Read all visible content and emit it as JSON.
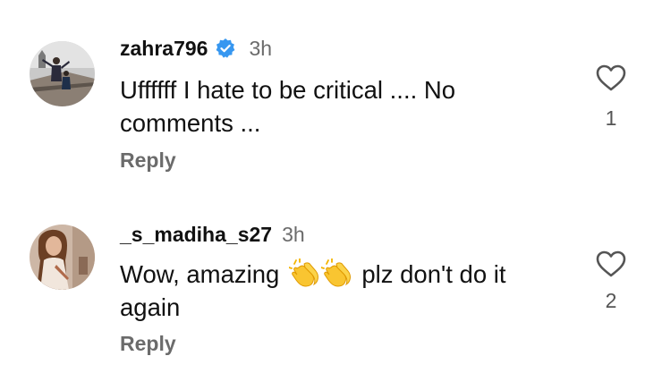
{
  "comments": [
    {
      "username": "zahra796",
      "verified": true,
      "time": "3h",
      "text_lines": [
        "Uffffff I hate to be critical .... No",
        "comments ..."
      ],
      "reply_label": "Reply",
      "like_icon": "heart-outline-icon",
      "like_count": "1"
    },
    {
      "username": "_s_madiha_s27",
      "verified": false,
      "time": "3h",
      "text_before": "Wow, amazing",
      "emojis": [
        "clapping-hands",
        "clapping-hands"
      ],
      "text_after": "plz don't do it",
      "text_line2": "again",
      "reply_label": "Reply",
      "like_icon": "heart-outline-icon",
      "like_count": "2"
    }
  ],
  "colors": {
    "verified_badge": "#3797f0",
    "secondary_text": "#6b6b6b",
    "primary_text": "#111111",
    "emoji_yellow": "#f9c531"
  }
}
